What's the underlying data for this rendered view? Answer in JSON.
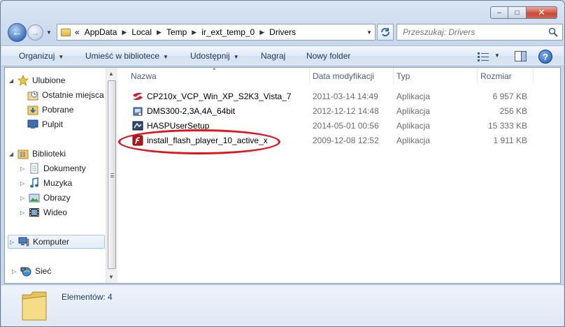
{
  "window": {
    "minimize_glyph": "–",
    "maximize_glyph": "□",
    "close_glyph": "✕"
  },
  "address_bar": {
    "overflow": "«",
    "crumbs": [
      "AppData",
      "Local",
      "Temp",
      "ir_ext_temp_0",
      "Drivers"
    ]
  },
  "search": {
    "placeholder": "Przeszukaj: Drivers"
  },
  "toolbar": {
    "organize": "Organizuj",
    "include_in_library": "Umieść w bibliotece",
    "share": "Udostępnij",
    "burn": "Nagraj",
    "new_folder": "Nowy folder"
  },
  "nav": {
    "favorites": "Ulubione",
    "recent": "Ostatnie miejsca",
    "downloads": "Pobrane",
    "desktop": "Pulpit",
    "libraries": "Biblioteki",
    "documents": "Dokumenty",
    "music": "Muzyka",
    "pictures": "Obrazy",
    "videos": "Wideo",
    "computer": "Komputer",
    "network": "Sieć"
  },
  "columns": {
    "name": "Nazwa",
    "modified": "Data modyfikacji",
    "type": "Typ",
    "size": "Rozmiar"
  },
  "files": [
    {
      "name": "CP210x_VCP_Win_XP_S2K3_Vista_7",
      "modified": "2011-03-14 14:49",
      "type": "Aplikacja",
      "size": "6 957 KB",
      "icon": "silabs-installer-icon"
    },
    {
      "name": "DMS300-2,3A,4A_64bit",
      "modified": "2012-12-12 14:48",
      "type": "Aplikacja",
      "size": "256 KB",
      "icon": "setup-app-icon"
    },
    {
      "name": "HASPUserSetup",
      "modified": "2014-05-01 00:56",
      "type": "Aplikacja",
      "size": "15 333 KB",
      "icon": "hasp-setup-icon"
    },
    {
      "name": "install_flash_player_10_active_x",
      "modified": "2009-12-08 12:52",
      "type": "Aplikacja",
      "size": "1 911 KB",
      "icon": "flash-player-icon"
    }
  ],
  "annotation_color": "#e2131b",
  "details": {
    "count_label": "Elementów: 4"
  }
}
